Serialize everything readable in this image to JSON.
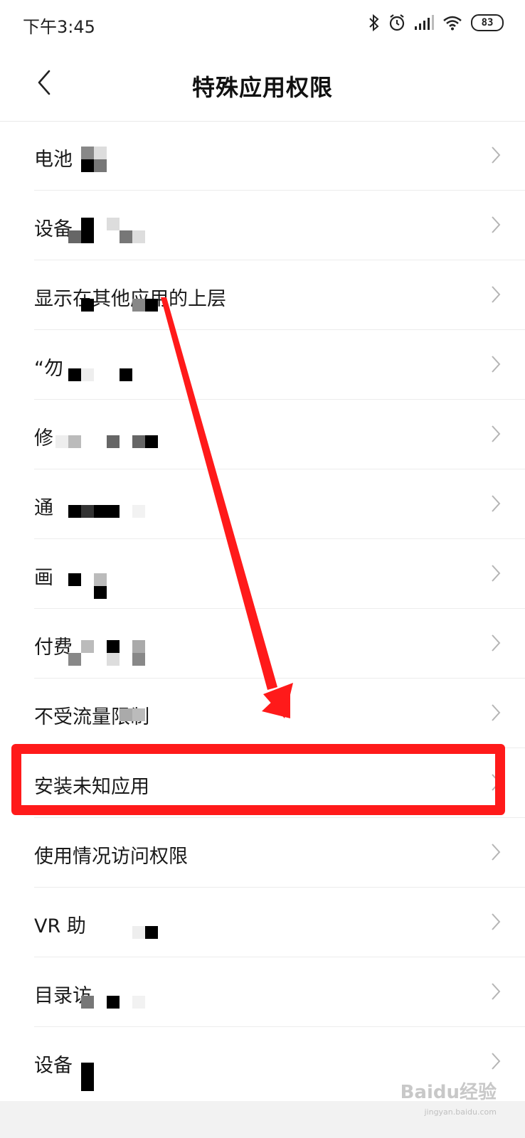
{
  "status_bar": {
    "time": "下午3:45",
    "battery": "83",
    "icons": [
      "bluetooth-icon",
      "alarm-icon",
      "signal-icon",
      "wifi-icon",
      "battery-icon"
    ]
  },
  "header": {
    "title": "特殊应用权限",
    "back_icon": "chevron-left-icon"
  },
  "items": [
    {
      "label": "电池"
    },
    {
      "label": "设备"
    },
    {
      "label": "显示在其他应用的上层"
    },
    {
      "label": "“勿"
    },
    {
      "label": "修"
    },
    {
      "label": "通"
    },
    {
      "label": "画"
    },
    {
      "label": "付费"
    },
    {
      "label": "不受流量限制"
    },
    {
      "label": "安装未知应用"
    },
    {
      "label": "使用情况访问权限"
    },
    {
      "label": "VR 助"
    },
    {
      "label": "目录访"
    },
    {
      "label": "设备"
    }
  ],
  "annotation": {
    "highlight_color": "#ff1a1a",
    "highlighted_item": "安装未知应用"
  },
  "watermark": {
    "text": "Baidu经验",
    "sub": "jingyan.baidu.com"
  },
  "colors": {
    "divider": "#ececec",
    "chevron": "#b5b5b5",
    "annotation_red": "#ff1a1a"
  }
}
